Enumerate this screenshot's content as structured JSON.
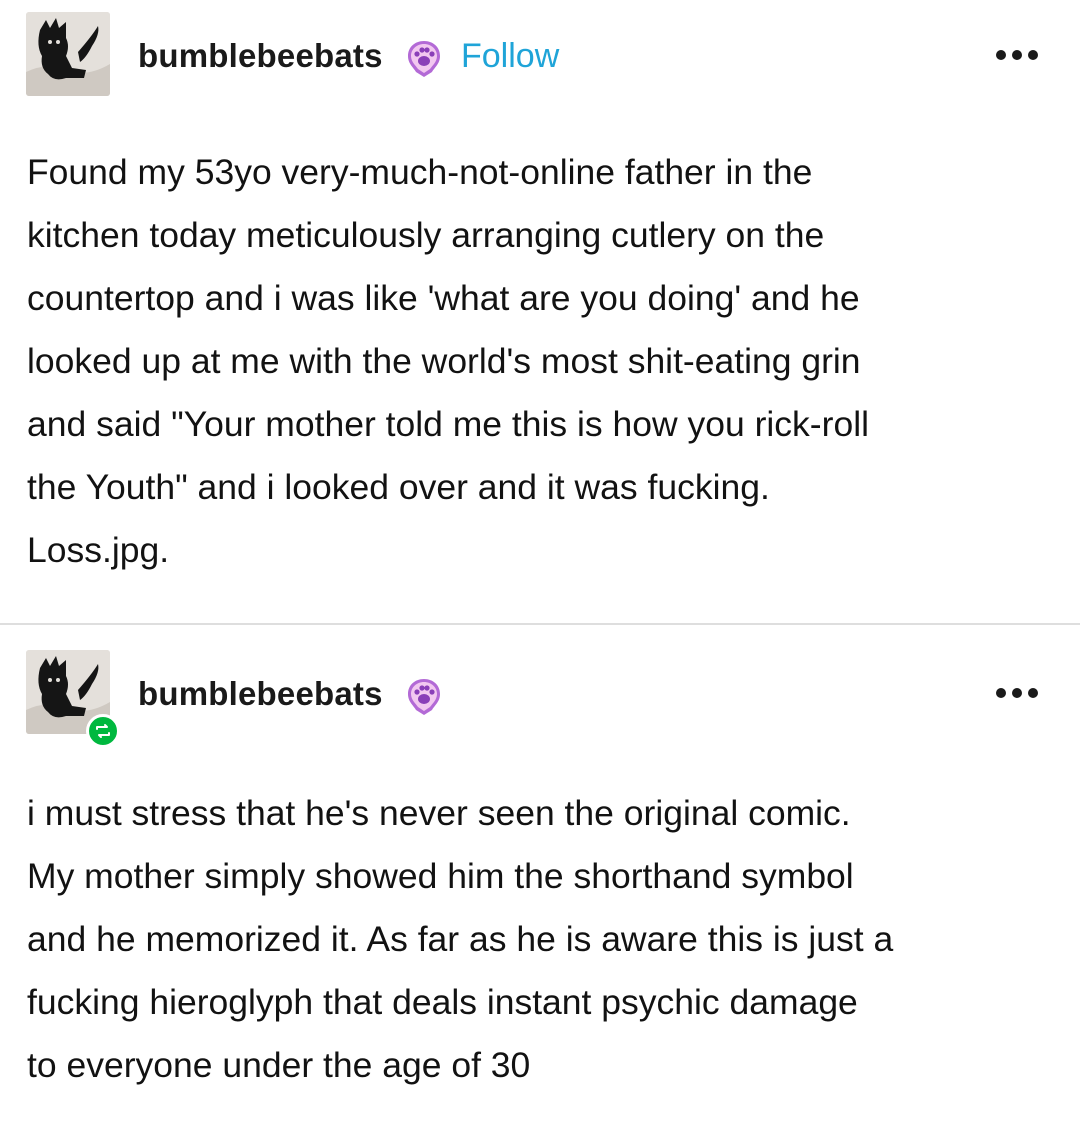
{
  "posts": [
    {
      "username": "bumblebeebats",
      "follow_label": "Follow",
      "badge_icon": "paw-print-badge-icon",
      "body": "Found my 53yo very-much-not-online father in the\nkitchen today meticulously arranging cutlery on the\ncountertop and i was like 'what are you doing' and he\nlooked up at me with the world's most shit-eating grin\nand said \"Your mother told me this is how you rick-roll\nthe Youth\" and i looked over and it was fucking.\nLoss.jpg."
    },
    {
      "username": "bumblebeebats",
      "badge_icon": "paw-print-badge-icon",
      "reblog_icon": "reblog-icon",
      "body": "i must stress that he's never seen the original comic.\nMy mother simply showed him the shorthand symbol\nand he memorized it. As far as he is aware this is just a\nfucking hieroglyph that deals instant psychic damage\nto everyone under the age of 30"
    }
  ],
  "colors": {
    "follow": "#1fa4d8",
    "reblog_badge": "#00b83f",
    "paw_badge": "#b36ad6",
    "divider": "#dedede"
  }
}
